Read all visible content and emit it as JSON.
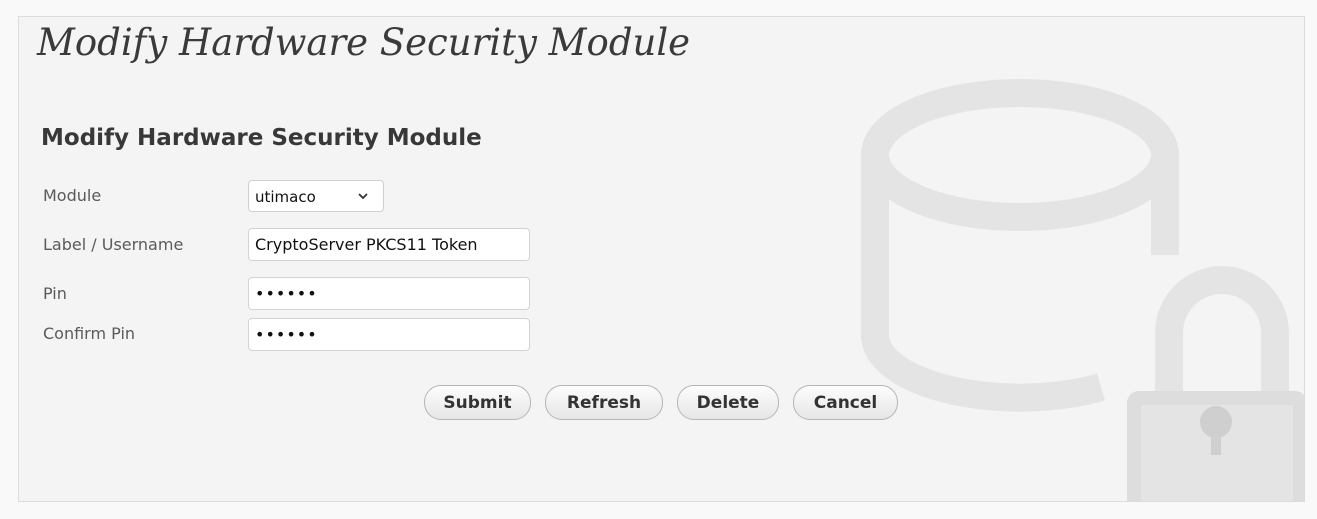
{
  "page": {
    "title": "Modify Hardware Security Module",
    "section_title": "Modify Hardware Security Module"
  },
  "form": {
    "module": {
      "label": "Module",
      "selected": "utimaco"
    },
    "label_username": {
      "label": "Label / Username",
      "value": "CryptoServer PKCS11 Token"
    },
    "pin": {
      "label": "Pin",
      "value": "123456"
    },
    "confirm_pin": {
      "label": "Confirm Pin",
      "value": "123456"
    }
  },
  "buttons": {
    "submit": "Submit",
    "refresh": "Refresh",
    "delete": "Delete",
    "cancel": "Cancel"
  },
  "icons": {
    "background": "database-lock-icon",
    "select": "chevron-down-icon"
  }
}
